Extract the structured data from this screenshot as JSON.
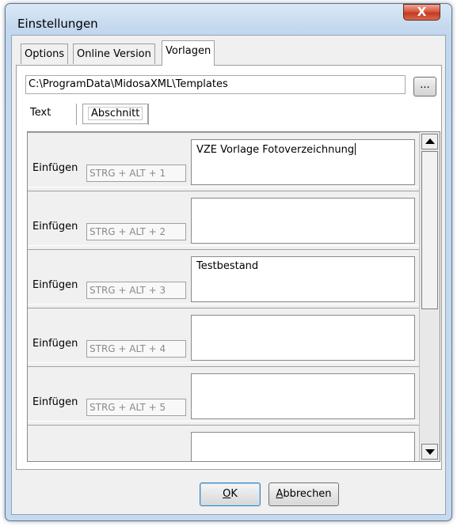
{
  "window": {
    "title": "Einstellungen",
    "close_glyph": "X"
  },
  "tabs": [
    {
      "label": "Options",
      "active": false
    },
    {
      "label": "Online Version",
      "active": false
    },
    {
      "label": "Vorlagen",
      "active": true
    }
  ],
  "path": {
    "value": "C:\\ProgramData\\MidosaXML\\Templates",
    "browse_label": "..."
  },
  "subtabs": [
    {
      "label": "Text",
      "active": false
    },
    {
      "label": "Abschnitt",
      "active": true
    }
  ],
  "templates": [
    {
      "label": "Einfügen",
      "hotkey": "STRG + ALT + 1",
      "text": "VZE Vorlage Fotoverzeichnung"
    },
    {
      "label": "Einfügen",
      "hotkey": "STRG + ALT + 2",
      "text": ""
    },
    {
      "label": "Einfügen",
      "hotkey": "STRG + ALT + 3",
      "text": "Testbestand"
    },
    {
      "label": "Einfügen",
      "hotkey": "STRG + ALT + 4",
      "text": ""
    },
    {
      "label": "Einfügen",
      "hotkey": "STRG + ALT + 5",
      "text": ""
    },
    {
      "label": "",
      "hotkey": "",
      "text": ""
    }
  ],
  "scrollbar": {
    "up_icon": "arrow-up-icon",
    "down_icon": "arrow-down-icon"
  },
  "buttons": {
    "ok": {
      "label_underlined": "O",
      "label_rest": "K"
    },
    "cancel": {
      "label_underlined": "A",
      "label_rest": "bbrechen"
    }
  }
}
